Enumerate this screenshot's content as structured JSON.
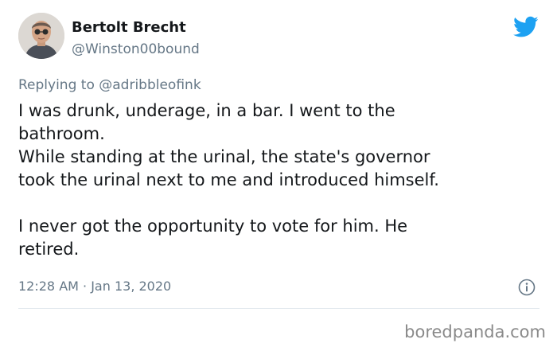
{
  "author": {
    "display_name": "Bertolt Brecht",
    "handle": "@Winston00bound"
  },
  "reply": {
    "prefix": "Replying to ",
    "mention": "@adribbleofink"
  },
  "tweet": {
    "lines": [
      "I was drunk, underage, in a bar. I went to the",
      "bathroom.",
      "While standing at the urinal, the state's governor",
      "took the urinal next to me and introduced himself.",
      "",
      "I never got the opportunity to vote for him. He",
      "retired."
    ]
  },
  "timestamp": "12:28 AM · Jan 13, 2020",
  "watermark": "boredpanda.com",
  "icons": {
    "brand": "twitter-bird-icon",
    "info": "info-icon"
  },
  "colors": {
    "twitter_blue": "#1da1f2",
    "text": "#14171a",
    "secondary": "#657786",
    "divider": "#e1e8ed"
  }
}
